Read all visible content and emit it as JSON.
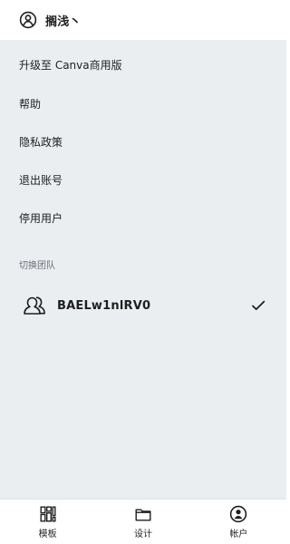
{
  "header": {
    "avatar_icon": "user-circle-icon",
    "username": "搁浅丶"
  },
  "menu": {
    "items": [
      {
        "label": "升级至 Canva商用版"
      },
      {
        "label": "帮助"
      },
      {
        "label": "隐私政策"
      },
      {
        "label": "退出账号"
      },
      {
        "label": "停用用户"
      }
    ]
  },
  "switch_team": {
    "section_label": "切换团队",
    "team": {
      "icon": "users-icon",
      "name": "BAELw1nlRV0",
      "selected": true,
      "check_icon": "check-icon"
    }
  },
  "bottom_nav": {
    "tabs": [
      {
        "label": "模板",
        "icon": "templates-grid-icon",
        "active": false
      },
      {
        "label": "设计",
        "icon": "folder-icon",
        "active": false
      },
      {
        "label": "帐户",
        "icon": "user-circle-icon",
        "active": true
      }
    ]
  },
  "colors": {
    "background": "#ebeef1",
    "surface": "#ffffff",
    "text": "#1f1f1f",
    "muted_text": "#6a6f75",
    "divider": "#dfe2e5"
  }
}
